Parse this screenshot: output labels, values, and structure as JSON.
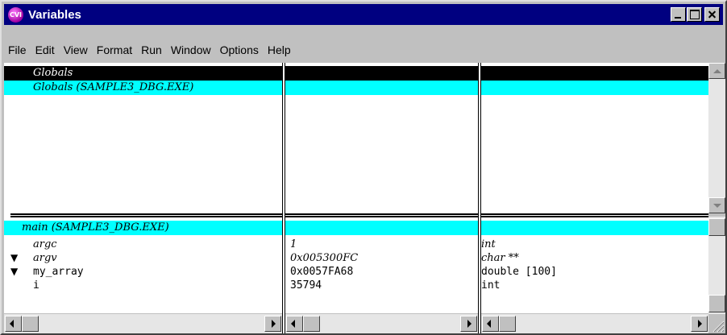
{
  "window": {
    "title": "Variables",
    "app_icon_text": "CVI"
  },
  "menu": [
    "File",
    "Edit",
    "View",
    "Format",
    "Run",
    "Window",
    "Options",
    "Help"
  ],
  "globals_pane": {
    "rows": [
      {
        "name": "Globals",
        "value": "",
        "type": ""
      },
      {
        "name": "Globals (SAMPLE3_DBG.EXE)",
        "value": "",
        "type": ""
      }
    ]
  },
  "locals_pane": {
    "header": "main (SAMPLE3_DBG.EXE)",
    "rows": [
      {
        "marker": "",
        "name": "argc",
        "value": "1",
        "type": "int"
      },
      {
        "marker": "▼",
        "name": "argv",
        "value": "0x005300FC",
        "type": "char **"
      },
      {
        "marker": "▼",
        "name": "my_array",
        "value": "0x0057FA68",
        "type": "double [100]"
      },
      {
        "marker": "",
        "name": "i",
        "value": "35794",
        "type": "int"
      }
    ]
  },
  "colors": {
    "title_bg": "#000080",
    "selected_black": "#000000",
    "selected_cyan": "#00ffff"
  }
}
